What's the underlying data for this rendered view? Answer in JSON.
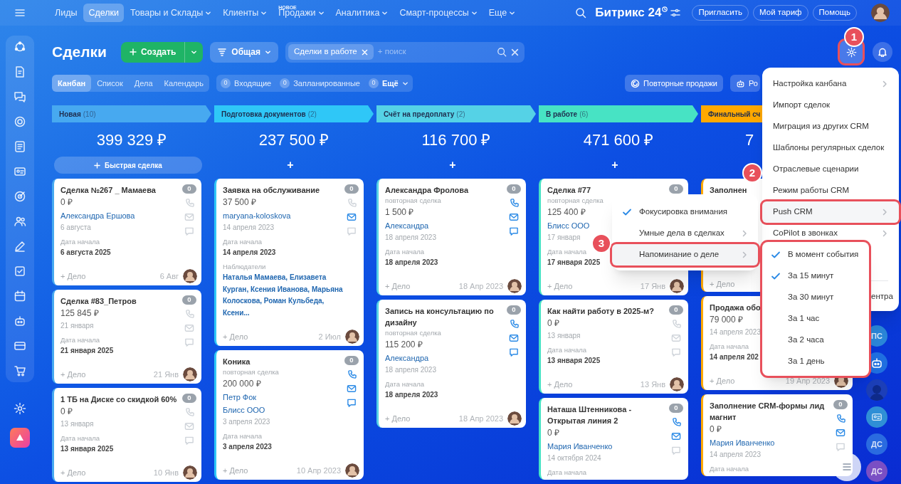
{
  "top_nav": {
    "items": [
      {
        "label": "Лиды",
        "selected": false,
        "dropdown": false
      },
      {
        "label": "Сделки",
        "selected": true,
        "dropdown": false
      },
      {
        "label": "Товары и Склады",
        "selected": false,
        "dropdown": true
      },
      {
        "label": "Клиенты",
        "selected": false,
        "dropdown": true
      },
      {
        "label": "Продажи",
        "selected": false,
        "dropdown": true,
        "badge": "НОВОЕ"
      },
      {
        "label": "Аналитика",
        "selected": false,
        "dropdown": true
      },
      {
        "label": "Смарт-процессы",
        "selected": false,
        "dropdown": true
      },
      {
        "label": "Еще",
        "selected": false,
        "dropdown": true
      }
    ],
    "brand": "Битрикс 24",
    "buttons": [
      "Пригласить",
      "Мой тариф",
      "Помощь"
    ]
  },
  "page": {
    "title": "Сделки",
    "create_button": "Создать",
    "filter_button": "Общая",
    "search": {
      "tag": "Сделки в работе",
      "placeholder": "+ поиск"
    },
    "settings_button": {
      "highlighted": true,
      "callout": "1"
    }
  },
  "view_tabs": [
    {
      "label": "Канбан",
      "selected": true
    },
    {
      "label": "Список",
      "selected": false
    },
    {
      "label": "Дела",
      "selected": false
    },
    {
      "label": "Календарь",
      "selected": false
    }
  ],
  "counters": [
    {
      "count": "0",
      "label": "Входящие",
      "dropdown": false
    },
    {
      "count": "0",
      "label": "Запланированные",
      "dropdown": false
    },
    {
      "count": "0",
      "label": "Ещё",
      "dropdown": true
    }
  ],
  "right_buttons": [
    {
      "label": "Повторные продажи"
    },
    {
      "label": "Ро"
    }
  ],
  "columns": [
    {
      "title": "Новая",
      "count": "(10)",
      "color": "#47a9f0",
      "total": "399 329 ₽",
      "add_label": "Быстрая сделка",
      "cards": [
        {
          "title": "Сделка №267 _ Мамаева",
          "amount": "0 ₽",
          "links": [
            "Александра Ершова"
          ],
          "date": "6 августа",
          "start_label": "Дата начала",
          "start_date": "6 августа 2025",
          "counter": "0",
          "phone": false,
          "mail": false,
          "chat": false,
          "add_label": "+ Дело",
          "footer_date": "6 Авг"
        },
        {
          "title": "Сделка #83_Петров",
          "amount": "125 845 ₽",
          "date": "21 января",
          "start_label": "Дата начала",
          "start_date": "21 января 2025",
          "counter": "0",
          "phone": false,
          "mail": false,
          "chat": false,
          "add_label": "+ Дело",
          "footer_date": "21 Янв"
        },
        {
          "title": "1 ТБ на Диске со скидкой 60%",
          "amount": "0 ₽",
          "date": "13 января",
          "start_label": "Дата начала",
          "start_date": "13 января 2025",
          "counter": "0",
          "phone": false,
          "mail": false,
          "chat": false,
          "add_label": "+ Дело",
          "footer_date": "10 Янв"
        }
      ]
    },
    {
      "title": "Подготовка документов",
      "count": "(2)",
      "color": "#2fc7f7",
      "total": "237 500 ₽",
      "add_label": "+",
      "cards": [
        {
          "title": "Заявка на обслуживание",
          "amount": "37 500 ₽",
          "links": [
            "maryana-koloskova"
          ],
          "date": "14 апреля 2023",
          "start_label": "Дата начала",
          "start_date": "14 апреля 2023",
          "observers_label": "Наблюдатели",
          "observers": "Наталья Мамаева, Елизавета Курган, Ксения Иванова, Марьяна Колоскова, Роман Кульбеда, Ксени...",
          "counter": "0",
          "phone": false,
          "mail": true,
          "chat": false,
          "add_label": "+ Дело",
          "footer_date": "2 Июл"
        },
        {
          "title": "Коника",
          "subtitle": "повторная сделка",
          "amount": "200 000 ₽",
          "links": [
            "Петр Фок",
            "Блисс ООО"
          ],
          "date": "3 апреля 2023",
          "start_label": "Дата начала",
          "start_date": "3 апреля 2023",
          "counter": "0",
          "phone": true,
          "mail": true,
          "chat": true,
          "add_label": "+ Дело",
          "footer_date": "10 Апр 2023"
        }
      ]
    },
    {
      "title": "Счёт на предоплату",
      "count": "(2)",
      "color": "#55d2e6",
      "total": "116 700 ₽",
      "add_label": "+",
      "cards": [
        {
          "title": "Александра Фролова",
          "subtitle": "повторная сделка",
          "amount": "1 500 ₽",
          "links": [
            "Александра"
          ],
          "date": "18 апреля 2023",
          "start_label": "Дата начала",
          "start_date": "18 апреля 2023",
          "counter": "0",
          "phone": true,
          "mail": true,
          "chat": true,
          "add_label": "+ Дело",
          "footer_date": "18 Апр 2023"
        },
        {
          "title": "Запись на консультацию по дизайну",
          "subtitle": "повторная сделка",
          "amount": "115 200 ₽",
          "links": [
            "Александра"
          ],
          "date": "18 апреля 2023",
          "start_label": "Дата начала",
          "start_date": "18 апреля 2023",
          "counter": "0",
          "phone": true,
          "mail": true,
          "chat": true,
          "add_label": "+ Дело",
          "footer_date": "18 Апр 2023"
        }
      ]
    },
    {
      "title": "В работе",
      "count": "(6)",
      "color": "#47e3c4",
      "total": "471 600 ₽",
      "add_label": "+",
      "cards": [
        {
          "title": "Сделка #77",
          "subtitle": "повторная сделка",
          "amount": "125 400 ₽",
          "links": [
            "Блисс ООО"
          ],
          "date": "17 января",
          "start_label": "Дата начала",
          "start_date": "17 января 2025",
          "counter": "0",
          "add_label": "+ Дело",
          "footer_date": "17 Янв"
        },
        {
          "title": "Как найти работу в 2025-м?",
          "amount": "0 ₽",
          "date": "13 января",
          "start_label": "Дата начала",
          "start_date": "13 января 2025",
          "counter": "0",
          "phone": false,
          "mail": false,
          "chat": false,
          "add_label": "+ Дело",
          "footer_date": "13 Янв"
        },
        {
          "title": "Наташа Штенникова - Открытая линия 2",
          "amount": "0 ₽",
          "links": [
            "Мария Иванченко"
          ],
          "date": "14 октября 2024",
          "start_label": "Дата начала",
          "counter": "0",
          "phone": true,
          "mail": true,
          "chat": false
        }
      ]
    },
    {
      "title": "Финальный сч",
      "color": "#ffa900",
      "total": "7",
      "cards": [
        {
          "title": "Заполнен",
          "add_label": "+ Дело"
        },
        {
          "title": "Продажа обо",
          "amount": "79 000 ₽",
          "date": "14 апреля 2023",
          "start_label": "Дата начала",
          "start_date": "14 апреля 202",
          "add_label": "+ Дело",
          "footer_date": "19 Апр 2023"
        },
        {
          "title": "Заполнение CRM-формы лид магнит",
          "amount": "0 ₽",
          "links": [
            "Мария Иванченко"
          ],
          "date": "14 апреля 2023",
          "start_label": "Дата начала",
          "counter": "0",
          "phone": true,
          "mail": true,
          "chat": false
        }
      ]
    }
  ],
  "settings_menu": {
    "items": [
      {
        "label": "Настройка канбана",
        "submenu": true,
        "highlighted": false
      },
      {
        "label": "Импорт сделок",
        "submenu": false,
        "highlighted": false
      },
      {
        "label": "Миграция из других CRM",
        "submenu": false,
        "highlighted": false
      },
      {
        "label": "Шаблоны регулярных сделок",
        "submenu": false,
        "highlighted": false
      },
      {
        "label": "Отраслевые сценарии",
        "submenu": false,
        "highlighted": false
      },
      {
        "label": "Режим работы CRM",
        "submenu": false,
        "highlighted": false
      },
      {
        "label": "Push CRM",
        "submenu": true,
        "highlighted": true,
        "callout": "2"
      },
      {
        "label": "CoPilot в звонках",
        "submenu": true,
        "highlighted": false
      }
    ],
    "footer_item": "ентра"
  },
  "push_submenu": {
    "items": [
      {
        "label": "Фокусировка внимания",
        "checked": true,
        "submenu": false,
        "highlighted": false
      },
      {
        "label": "Умные дела в сделках",
        "checked": false,
        "submenu": true,
        "highlighted": false
      },
      {
        "label": "Напоминание о деле",
        "checked": false,
        "submenu": true,
        "highlighted": true,
        "callout": "3"
      }
    ]
  },
  "reminder_submenu": {
    "highlighted": true,
    "items": [
      {
        "label": "В момент события",
        "checked": true
      },
      {
        "label": "За 15 минут",
        "checked": true
      },
      {
        "label": "За 30 минут",
        "checked": false
      },
      {
        "label": "За 1 час",
        "checked": false
      },
      {
        "label": "За 2 часа",
        "checked": false
      },
      {
        "label": "За 1 день",
        "checked": false
      }
    ]
  },
  "right_rail": [
    {
      "kind": "initials",
      "text": "ПС",
      "color": "#2a86d8"
    },
    {
      "kind": "robot",
      "color": "#1f6fe0"
    },
    {
      "kind": "silhouette",
      "color": "#1c3fb8"
    },
    {
      "kind": "card",
      "color": "#2f8fd6"
    },
    {
      "kind": "initials",
      "text": "ДС",
      "color": "#2a6be0"
    },
    {
      "kind": "initials",
      "text": "ДС",
      "color": "#7a4fc4"
    }
  ]
}
